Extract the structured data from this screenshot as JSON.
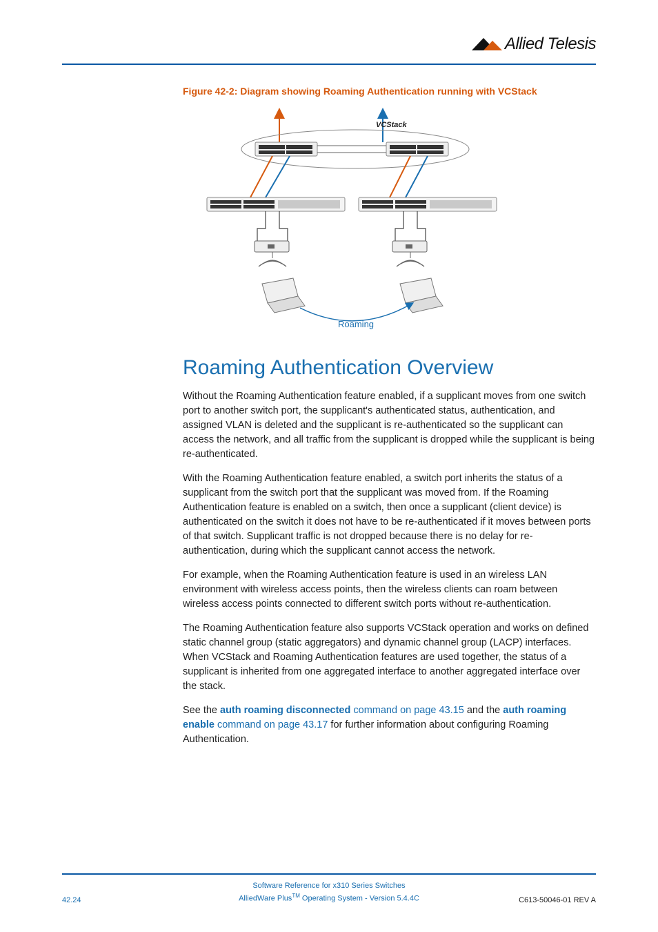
{
  "header": {
    "brand_text": "Allied Telesis"
  },
  "figure": {
    "caption": "Figure 42-2: Diagram showing Roaming Authentication running with VCStack",
    "label_top": "VCStack",
    "label_bottom": "Roaming"
  },
  "heading": "Roaming Authentication Overview",
  "paragraphs": {
    "p1": "Without the Roaming Authentication feature enabled, if a supplicant moves from one switch port to another switch port, the supplicant's authenticated status, authentication, and assigned VLAN is deleted and the supplicant is re-authenticated so the supplicant can access the network, and all traffic from the supplicant is dropped while the supplicant is being re-authenticated.",
    "p2": "With the Roaming Authentication feature enabled, a switch port inherits the status of a supplicant from the switch port that the supplicant was moved from. If the Roaming Authentication feature is enabled on a switch, then once a supplicant (client device) is authenticated on the switch it does not have to be re-authenticated if it moves between ports of that switch. Supplicant traffic is not dropped because there is no delay for re-authentication, during which the supplicant cannot access the network.",
    "p3": "For example, when the Roaming Authentication feature is used in an wireless LAN environment with wireless access points, then the wireless clients can roam between wireless access points connected to different switch ports without re-authentication.",
    "p4": "The Roaming Authentication feature also supports VCStack operation and works on defined static channel group (static aggregators) and dynamic channel group (LACP) interfaces. When VCStack and Roaming Authentication features are used together, the status of a supplicant is inherited from one aggregated interface to another aggregated interface over the stack.",
    "p5_pre": "See the ",
    "p5_link1_bold": "auth roaming disconnected",
    "p5_link1_rest": " command on page 43.15",
    "p5_mid": " and the ",
    "p5_link2_bold": "auth roaming enable",
    "p5_link2_rest": " command on page 43.17",
    "p5_post": " for further information about configuring Roaming Authentication."
  },
  "footer": {
    "line1": "Software Reference for x310 Series Switches",
    "line2_pre": "AlliedWare Plus",
    "line2_sup": "TM",
    "line2_post": " Operating System  - Version 5.4.4C",
    "page_num": "42.24",
    "doc_rev": "C613-50046-01 REV A"
  }
}
